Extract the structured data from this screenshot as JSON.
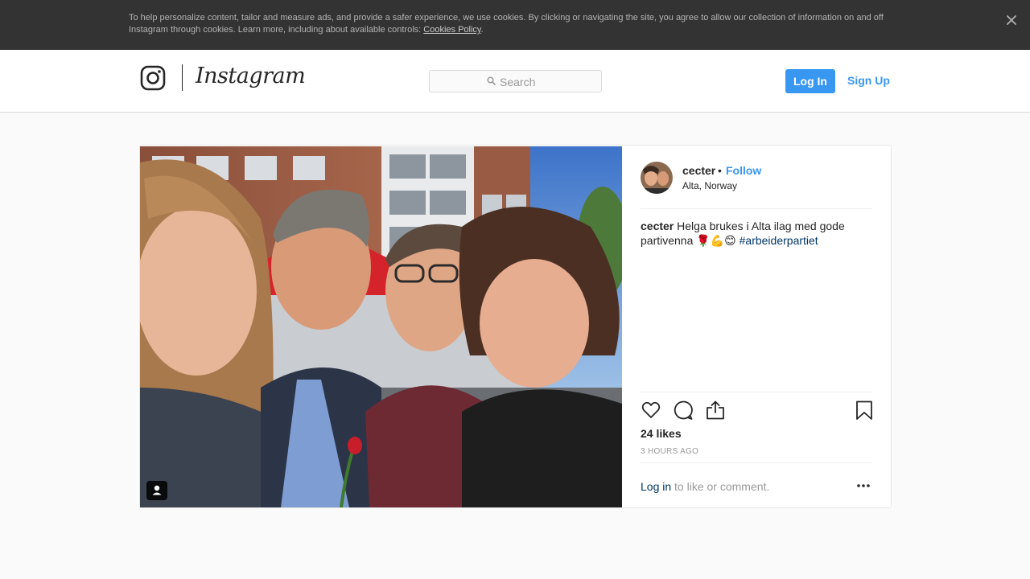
{
  "cookie_banner": {
    "text": "To help personalize content, tailor and measure ads, and provide a safer experience, we use cookies. By clicking or navigating the site, you agree to allow our collection of information on and off Instagram through cookies. Learn more, including about available controls: ",
    "link": "Cookies Policy",
    "end": "."
  },
  "header": {
    "brand": "Instagram",
    "search_placeholder": "Search",
    "login": "Log In",
    "signup": "Sign Up"
  },
  "post": {
    "username": "cecter",
    "separator": "•",
    "follow": "Follow",
    "location": "Alta, Norway",
    "caption_text": " Helga brukes i Alta ilag med gode partivenna 🌹💪😊 ",
    "hashtag": "#arbeiderpartiet",
    "likes": "24 likes",
    "time": "3 HOURS AGO",
    "login_link": "Log in",
    "login_rest": " to like or comment."
  },
  "colors": {
    "accent": "#3897f0",
    "banner": "#333333",
    "link_dark": "#003569"
  },
  "icons": [
    "instagram-glyph-icon",
    "close-icon",
    "search-icon",
    "heart-icon",
    "comment-icon",
    "share-icon",
    "bookmark-icon",
    "more-icon",
    "user-tag-icon"
  ]
}
